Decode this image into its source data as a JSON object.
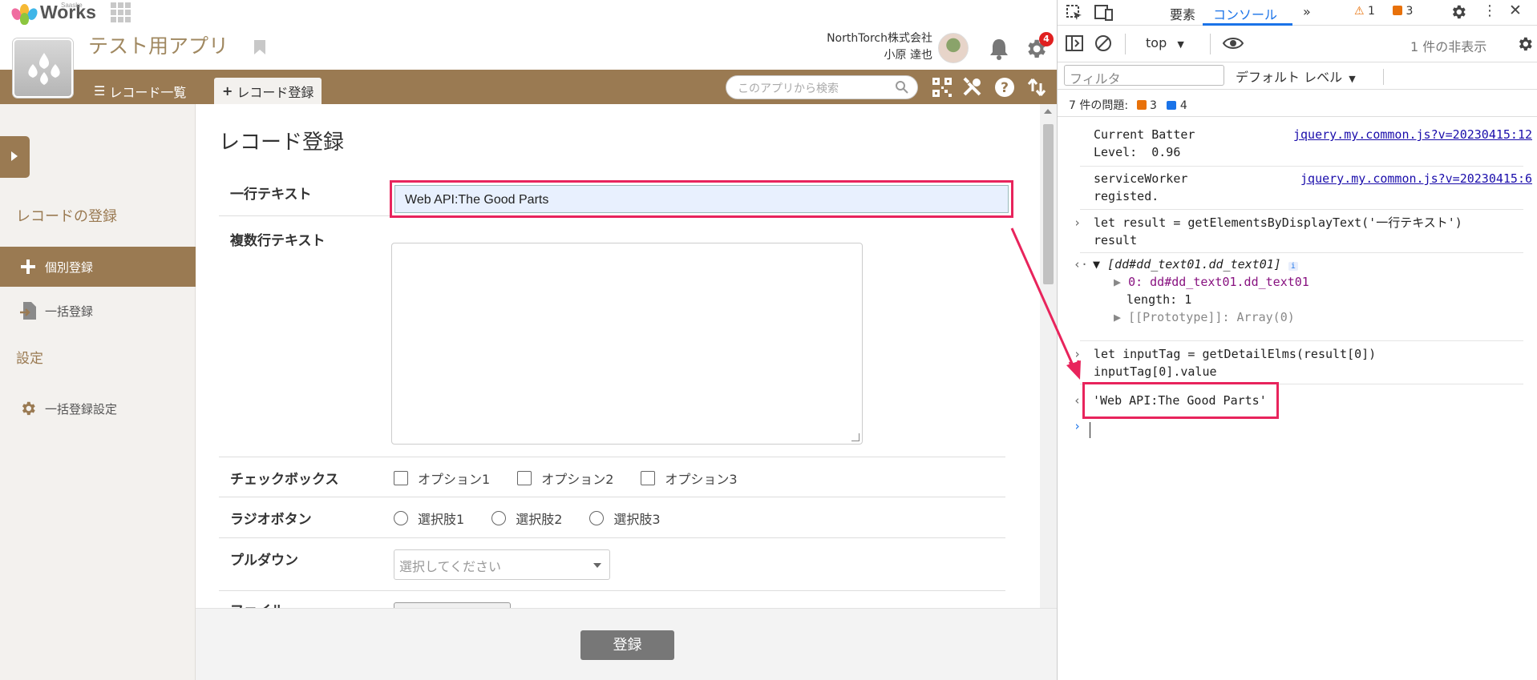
{
  "colors": {
    "brand": "#9a7a52",
    "highlight": "#e8245c",
    "devtools_accent": "#1a73e8"
  },
  "topbar": {
    "brand": "Works",
    "brand_sub": "Saaske"
  },
  "header": {
    "app_title": "テスト用アプリ",
    "company": "NorthTorch株式会社",
    "user_name": "小原 達也",
    "notification_count": "4"
  },
  "nav": {
    "tab_list": "レコード一覧",
    "tab_new": "レコード登録",
    "search_placeholder": "このアプリから検索"
  },
  "sidebar": {
    "section_title": "レコードの登録",
    "item_single": "個別登録",
    "item_bulk": "一括登録",
    "settings_title": "設定",
    "item_bulk_settings": "一括登録設定"
  },
  "form": {
    "title": "レコード登録",
    "text_label": "一行テキスト",
    "text_value": "Web API:The Good Parts",
    "multi_label": "複数行テキスト",
    "checkbox_label": "チェックボックス",
    "checkbox_options": [
      "オプション1",
      "オプション2",
      "オプション3"
    ],
    "radio_label": "ラジオボタン",
    "radio_options": [
      "選択肢1",
      "選択肢2",
      "選択肢3"
    ],
    "pulldown_label": "プルダウン",
    "pulldown_placeholder": "選択してください",
    "file_label": "ファイル",
    "submit": "登録"
  },
  "devtools": {
    "tab_elements": "要素",
    "tab_console": "コンソール",
    "warn_count": "1",
    "error_count": "3",
    "context": "top",
    "hidden_count": "1 件の非表示",
    "filter_placeholder": "フィルタ",
    "level": "デフォルト レベル",
    "issues_label": "7 件の問題:",
    "issues_error": "3",
    "issues_info": "4",
    "log1_text": "Current Batter\nLevel:  0.96",
    "log1_src": "jquery.my.common.js?v=20230415:12",
    "log2_text": "serviceWorker\nregisted.",
    "log2_src": "jquery.my.common.js?v=20230415:6",
    "cmd1_line1": "let result = getElementsByDisplayText('一行テキスト')",
    "cmd1_line2": "result",
    "out1_head": "[dd#dd_text01.dd_text01]",
    "out1_item": "0: dd#dd_text01.dd_text01",
    "out1_length": "length: 1",
    "out1_proto": "[[Prototype]]: Array(0)",
    "cmd2_line1": "let inputTag = getDetailElms(result[0])",
    "cmd2_line2": "inputTag[0].value",
    "result": "'Web API:The Good Parts'"
  }
}
